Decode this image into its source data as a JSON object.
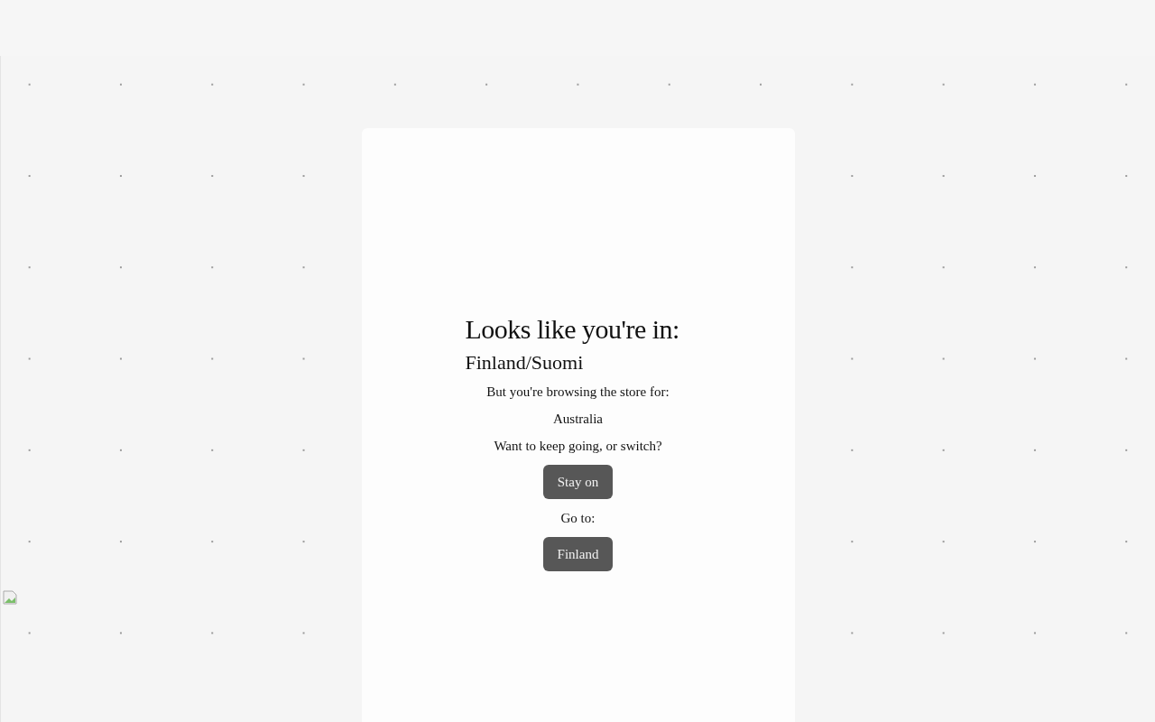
{
  "dialog": {
    "heading": "Looks like you're in:",
    "detected_country": "Finland/Suomi",
    "message": "But you're browsing the store for:",
    "current_store": "Australia",
    "question": "Want to keep going, or switch?",
    "stay_button": "Stay on",
    "go_to_label": "Go to:",
    "switch_button": "Finland"
  }
}
